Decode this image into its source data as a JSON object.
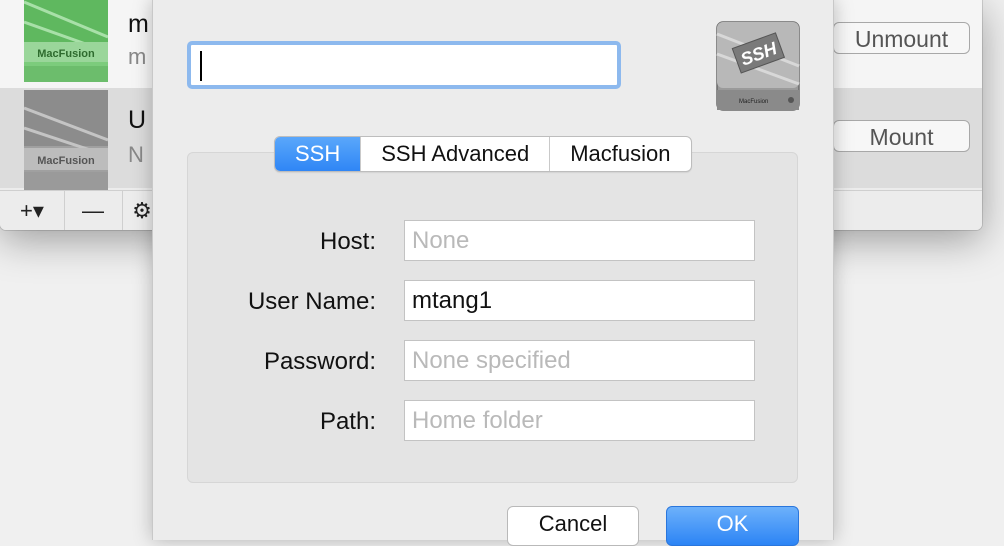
{
  "background_window": {
    "rows": [
      {
        "title": "m",
        "subtitle": "m",
        "action_label": "Unmount"
      },
      {
        "title": "U",
        "subtitle": "N",
        "action_label": "Mount"
      }
    ],
    "drive_label": "MacFusion",
    "toolbar": {
      "add_label": "+▾",
      "remove_label": "—",
      "settings_label": "⚙"
    }
  },
  "dialog": {
    "name_value": "",
    "logo_text": "SSH",
    "logo_sub": "MacFusion",
    "tabs": [
      {
        "label": "SSH",
        "active": true
      },
      {
        "label": "SSH Advanced",
        "active": false
      },
      {
        "label": "Macfusion",
        "active": false
      }
    ],
    "fields": {
      "host": {
        "label": "Host:",
        "value": "",
        "placeholder": "None"
      },
      "username": {
        "label": "User Name:",
        "value": "mtang1",
        "placeholder": ""
      },
      "password": {
        "label": "Password:",
        "value": "",
        "placeholder": "None specified"
      },
      "path": {
        "label": "Path:",
        "value": "",
        "placeholder": "Home folder"
      }
    },
    "buttons": {
      "cancel_label": "Cancel",
      "ok_label": "OK"
    }
  },
  "colors": {
    "accent": "#2f86f5",
    "focus_ring": "#8db9ee",
    "drive_green": "#3fa84a"
  }
}
